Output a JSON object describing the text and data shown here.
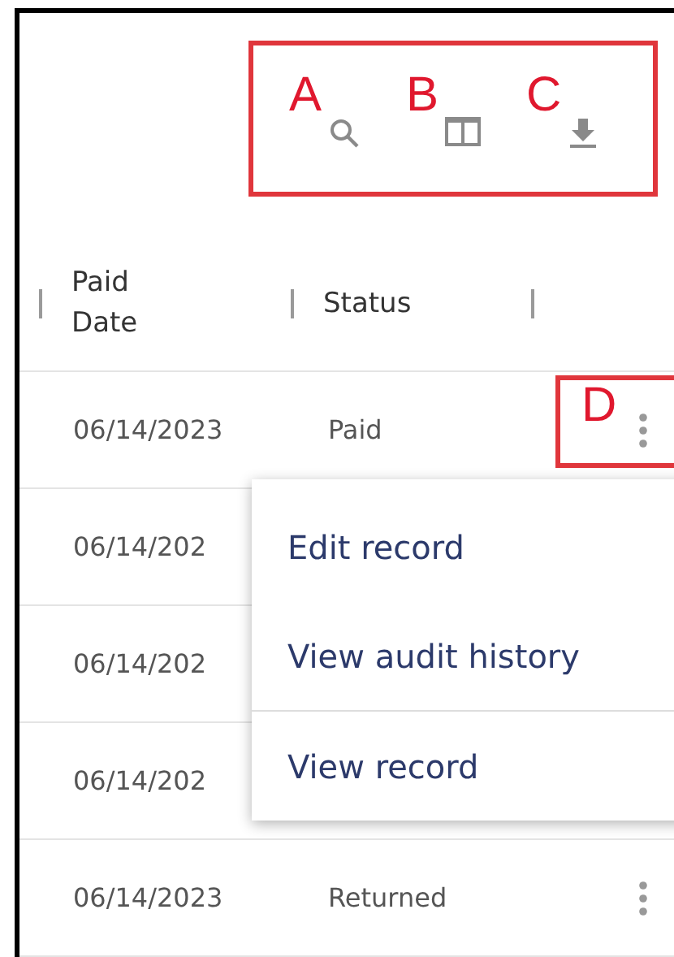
{
  "toolbar": {
    "labels": [
      "A",
      "B",
      "C"
    ]
  },
  "columns": [
    {
      "label": "Paid Date"
    },
    {
      "label": "Status"
    }
  ],
  "rows": [
    {
      "paid_date": "06/14/2023",
      "status": "Paid",
      "annotation": "D"
    },
    {
      "paid_date": "06/14/202"
    },
    {
      "paid_date": "06/14/202"
    },
    {
      "paid_date": "06/14/202"
    },
    {
      "paid_date": "06/14/2023",
      "status": "Returned"
    }
  ],
  "menu": {
    "items": [
      {
        "label": "Edit record",
        "divider_after": false
      },
      {
        "label": "View audit history",
        "divider_after": true
      },
      {
        "label": "View record",
        "divider_after": false
      }
    ]
  }
}
